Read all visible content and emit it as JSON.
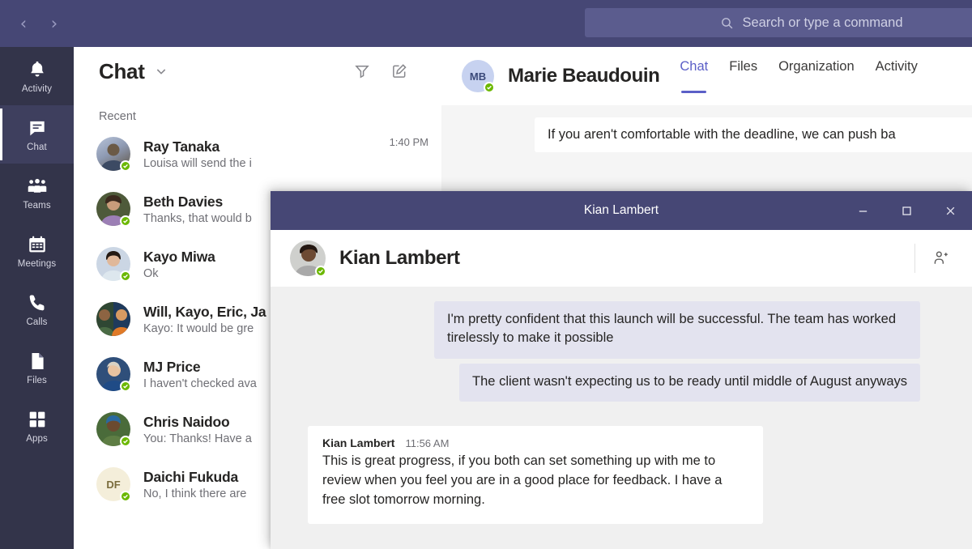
{
  "colors": {
    "brand_purple": "#464775",
    "accent": "#5b5fc7",
    "rail": "#33344a",
    "presence_available": "#6bb700",
    "bubble": "#e3e3ef",
    "popup_body": "#f0f0f0"
  },
  "topbar": {
    "back_icon": "chevron-left-icon",
    "forward_icon": "chevron-right-icon",
    "search": {
      "icon": "search-icon",
      "placeholder": "Search or type a command",
      "value": ""
    }
  },
  "rail": {
    "items": [
      {
        "label": "Activity",
        "icon": "bell-icon",
        "selected": false
      },
      {
        "label": "Chat",
        "icon": "chat-bubble-icon",
        "selected": true
      },
      {
        "label": "Teams",
        "icon": "people-icon",
        "selected": false
      },
      {
        "label": "Meetings",
        "icon": "calendar-icon",
        "selected": false
      },
      {
        "label": "Calls",
        "icon": "phone-icon",
        "selected": false
      },
      {
        "label": "Files",
        "icon": "document-icon",
        "selected": false
      },
      {
        "label": "Apps",
        "icon": "grid-icon",
        "selected": false
      }
    ]
  },
  "chat_list": {
    "title": "Chat",
    "title_chevron_icon": "chevron-down-icon",
    "filter_icon": "filter-icon",
    "compose_icon": "compose-new-chat-icon",
    "section_label": "Recent",
    "items": [
      {
        "name": "Ray Tanaka",
        "preview": "Louisa will send the i",
        "time": "1:40 PM",
        "presence": "available",
        "avatar_type": "photo",
        "avatar_color": "#b8c4d9"
      },
      {
        "name": "Beth Davies",
        "preview": "Thanks, that would b",
        "time": "",
        "presence": "available",
        "avatar_type": "photo",
        "avatar_color": "#4e5a3a"
      },
      {
        "name": "Kayo Miwa",
        "preview": "Ok",
        "time": "",
        "presence": "available",
        "avatar_type": "photo",
        "avatar_color": "#cbd6e4"
      },
      {
        "name": "Will, Kayo, Eric, Ja",
        "preview": "Kayo: It would be gre",
        "time": "",
        "presence": "none",
        "avatar_type": "group",
        "avatar_color": "#7a5a3a"
      },
      {
        "name": "MJ Price",
        "preview": "I haven't checked ava",
        "time": "",
        "presence": "available",
        "avatar_type": "photo",
        "avatar_color": "#2f4f7a"
      },
      {
        "name": "Chris Naidoo",
        "preview": "You: Thanks! Have a ",
        "time": "",
        "presence": "available",
        "avatar_type": "photo",
        "avatar_color": "#4a6b3a"
      },
      {
        "name": "Daichi Fukuda",
        "preview": "No, I think there are ",
        "time": "",
        "presence": "available",
        "avatar_type": "initials",
        "avatar_initials": "DF",
        "avatar_color": "#f4eeda"
      }
    ]
  },
  "conversation": {
    "header": {
      "avatar_initials": "MB",
      "name": "Marie Beaudouin",
      "presence": "available",
      "tabs": [
        {
          "label": "Chat",
          "active": true
        },
        {
          "label": "Files",
          "active": false
        },
        {
          "label": "Organization",
          "active": false
        },
        {
          "label": "Activity",
          "active": false
        }
      ]
    },
    "messages": [
      {
        "text": "If you aren't comfortable with the deadline, we can push ba"
      }
    ]
  },
  "popup": {
    "title": "Kian Lambert",
    "window_controls": [
      {
        "name": "minimize",
        "icon": "minimize-icon"
      },
      {
        "name": "maximize",
        "icon": "maximize-icon"
      },
      {
        "name": "close",
        "icon": "close-icon"
      }
    ],
    "header": {
      "name": "Kian Lambert",
      "presence": "available",
      "add_people_icon": "add-people-icon"
    },
    "messages": [
      {
        "type": "outgoing-bubble",
        "text": "I'm pretty confident that this launch will be successful. The team has worked tirelessly to make it possible"
      },
      {
        "type": "outgoing-bubble",
        "text": "The client wasn't expecting us to be ready until middle of August anyways"
      },
      {
        "type": "incoming-card",
        "author": "Kian Lambert",
        "time": "11:56 AM",
        "text": "This is great progress, if you both can set something up with me to review when you feel you are in a good place for feedback. I have a free slot tomorrow morning."
      }
    ]
  }
}
